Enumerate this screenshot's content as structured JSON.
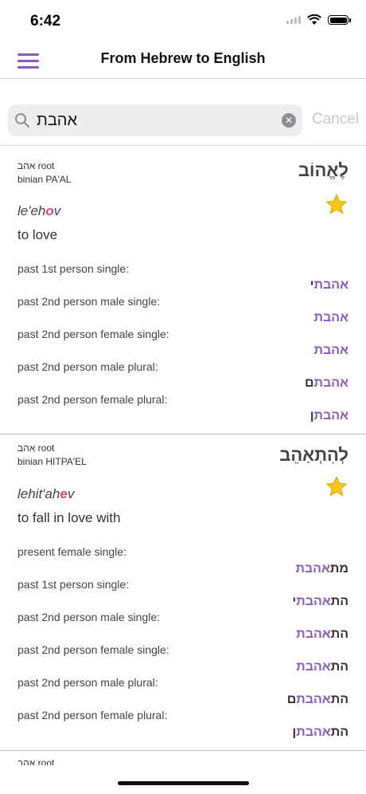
{
  "status": {
    "time": "6:42"
  },
  "nav": {
    "title": "From Hebrew to English"
  },
  "search": {
    "value": "אהבת",
    "cancel_label": "Cancel",
    "clear_symbol": "✕"
  },
  "entries": [
    {
      "root": "אהב root",
      "binian": "binian PA'AL",
      "word": "לֶאֱהוֹב",
      "translit": {
        "before": "le'eh",
        "stress": "o",
        "after": "v"
      },
      "meaning": "to love",
      "forms": [
        {
          "label": "past 1st person single:",
          "prefix": "",
          "main": "אהבת",
          "suffix": "י"
        },
        {
          "label": "past 2nd person male single:",
          "prefix": "",
          "main": "אהבת",
          "suffix": ""
        },
        {
          "label": "past 2nd person female single:",
          "prefix": "",
          "main": "אהבת",
          "suffix": ""
        },
        {
          "label": "past 2nd person male plural:",
          "prefix": "",
          "main": "אהבת",
          "suffix": "ם"
        },
        {
          "label": "past 2nd person female plural:",
          "prefix": "",
          "main": "אהבת",
          "suffix": "ן"
        }
      ]
    },
    {
      "root": "אהב root",
      "binian": "binian HITPA'EL",
      "word": "לְהִתְאַהֵב",
      "translit": {
        "before": "lehit'ah",
        "stress": "e",
        "after": "v"
      },
      "meaning": "to fall in love with",
      "forms": [
        {
          "label": "present female single:",
          "prefix": "מת",
          "main": "אהבת",
          "suffix": ""
        },
        {
          "label": "past 1st person single:",
          "prefix": "הת",
          "main": "אהבת",
          "suffix": "י"
        },
        {
          "label": "past 2nd person male single:",
          "prefix": "הת",
          "main": "אהבת",
          "suffix": ""
        },
        {
          "label": "past 2nd person female single:",
          "prefix": "הת",
          "main": "אהבת",
          "suffix": ""
        },
        {
          "label": "past 2nd person male plural:",
          "prefix": "הת",
          "main": "אהבת",
          "suffix": "ם"
        },
        {
          "label": "past 2nd person female plural:",
          "prefix": "הת",
          "main": "אהבת",
          "suffix": "ן"
        }
      ]
    }
  ],
  "partial_entry": {
    "root": "אהב root"
  },
  "colors": {
    "accent": "#8a5bc0",
    "stress": "#e0457b",
    "star": "#f5c518"
  }
}
